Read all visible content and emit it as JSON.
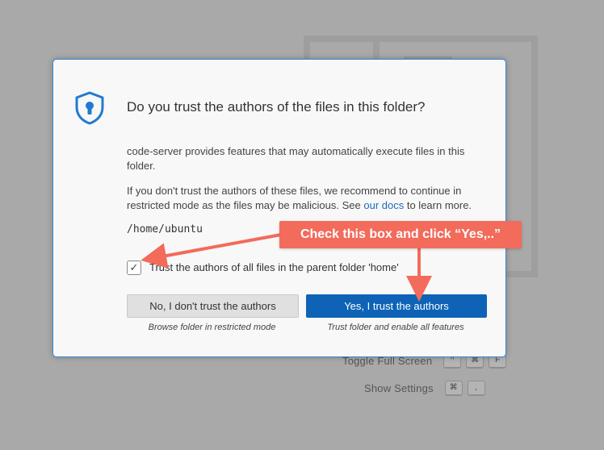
{
  "background": {
    "shortcuts": [
      {
        "label": "Toggle Full Screen",
        "keys": [
          "^",
          "⌘",
          "F"
        ]
      },
      {
        "label": "Show Settings",
        "keys": [
          "⌘",
          ","
        ]
      }
    ]
  },
  "dialog": {
    "title": "Do you trust the authors of the files in this folder?",
    "message_1": "code-server provides features that may automatically execute files in this folder.",
    "message_2_before": "If you don't trust the authors of these files, we recommend to continue in restricted mode as the files may be malicious. See ",
    "message_2_link": "our docs",
    "message_2_after": " to learn more.",
    "path": "/home/ubuntu",
    "checkbox_checked": true,
    "checkbox_label": "Trust the authors of all files in the parent folder 'home'",
    "no_button": "No, I don't trust the authors",
    "no_caption": "Browse folder in restricted mode",
    "yes_button": "Yes, I trust the authors",
    "yes_caption": "Trust folder and enable all features"
  },
  "annotation": {
    "callout": "Check this box and click “Yes,..”",
    "color": "#f26b5b"
  },
  "colors": {
    "accent": "#0e63b6",
    "dialog_border": "#3a86d4",
    "link": "#1f6dbc"
  }
}
